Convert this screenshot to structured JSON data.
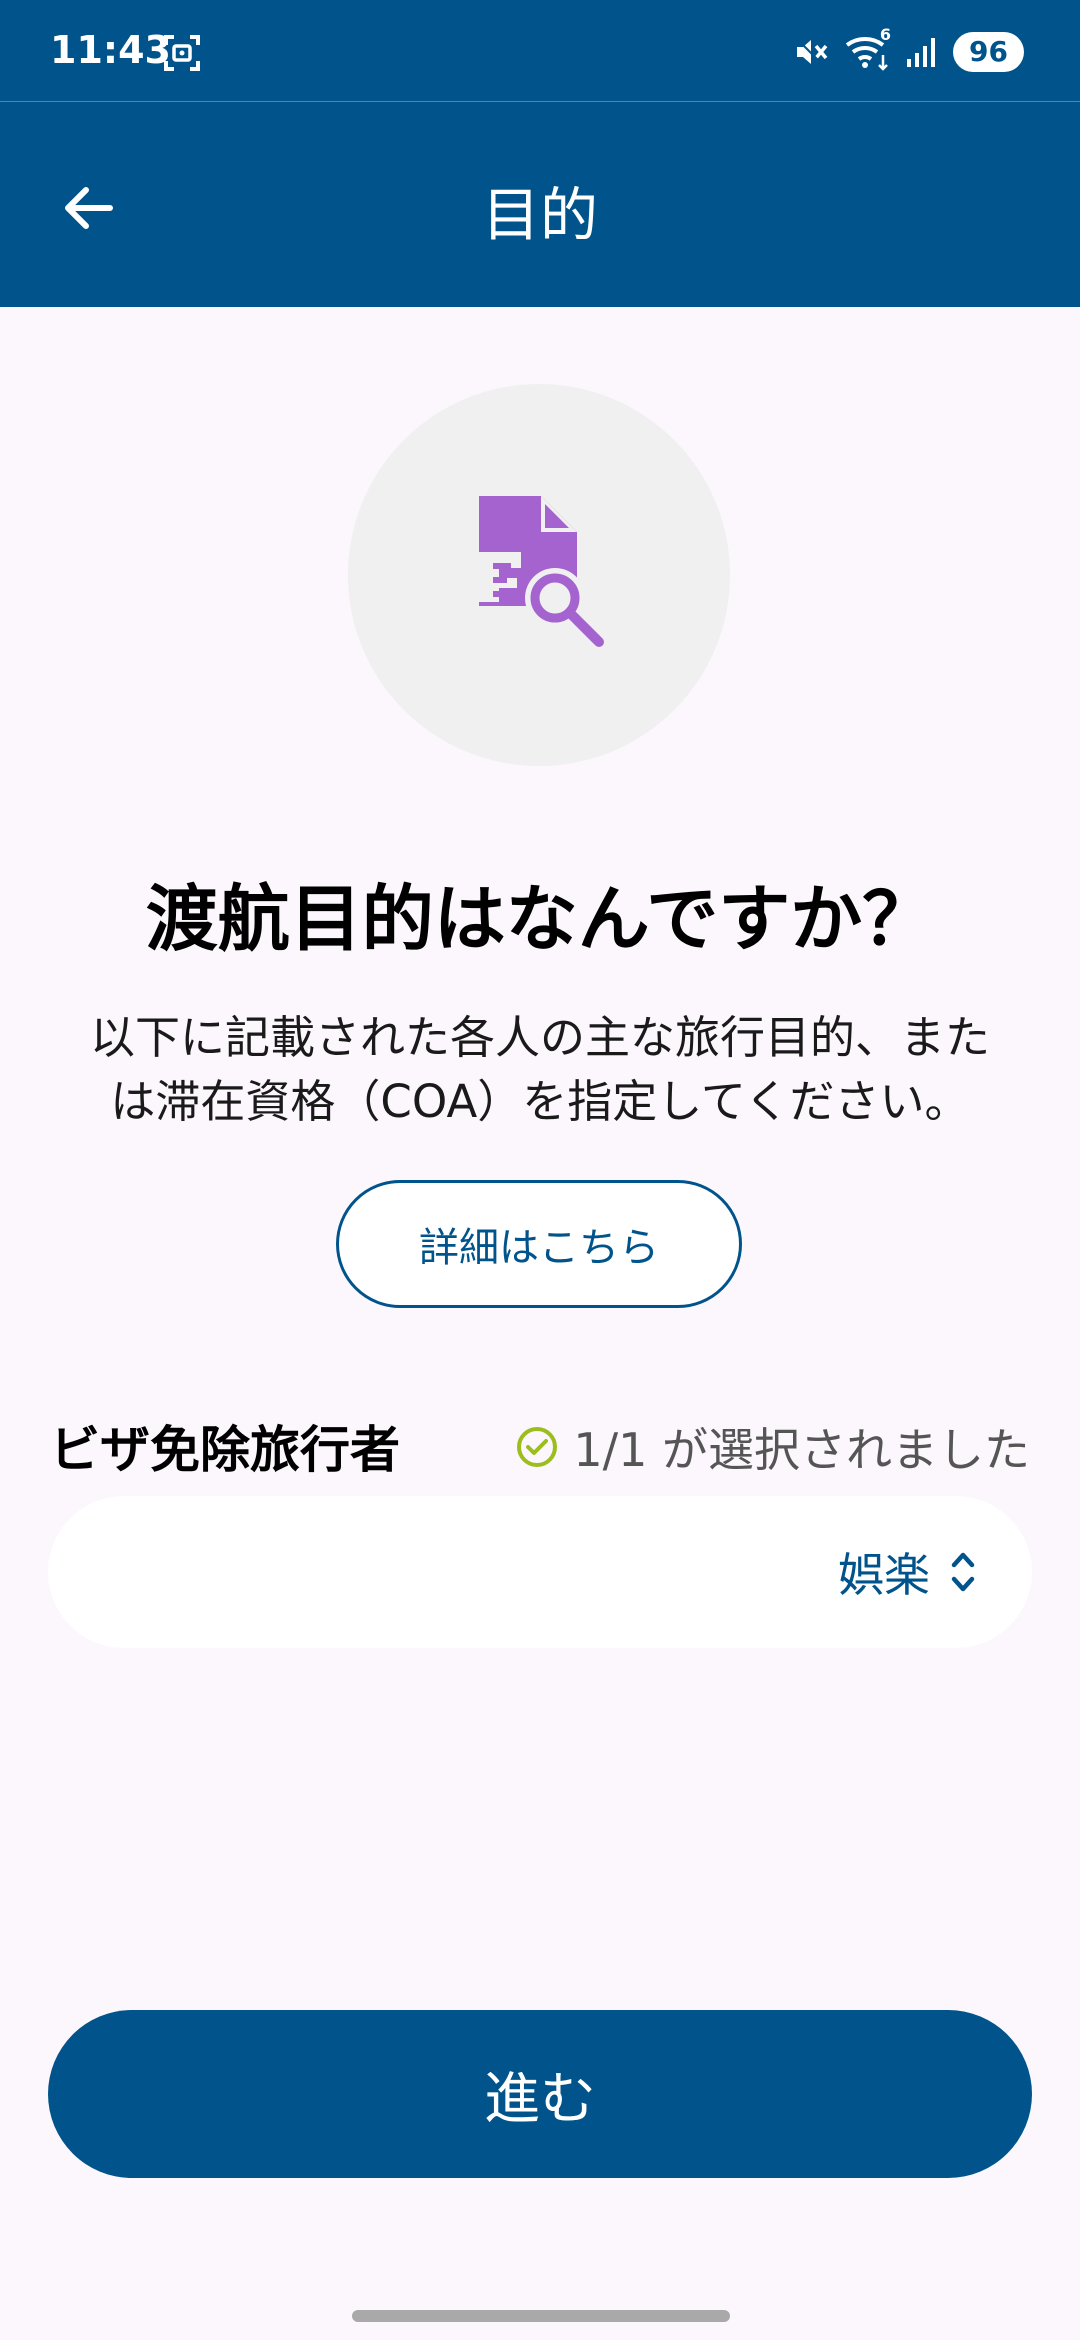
{
  "status_bar": {
    "time": "11:43",
    "battery": "96",
    "network_badge": "6"
  },
  "app_bar": {
    "title": "目的"
  },
  "main": {
    "illustration_icon": "document-search-icon",
    "question_title": "渡航目的はなんですか？",
    "description_line1": "以下に記載された各人の主な旅行目的、また",
    "description_line2": "は滞在資格（COA）を指定してください。",
    "details_button_label": "詳細はこちら",
    "section_label": "ビザ免除旅行者",
    "selected_status": "1/1 が選択されました",
    "purpose_select_value": "娯楽"
  },
  "footer": {
    "proceed_label": "進む"
  },
  "colors": {
    "primary": "#01548B",
    "icon_purple": "#A463CF",
    "check_green": "#9BBE1D",
    "background": "#FCF6FD"
  }
}
